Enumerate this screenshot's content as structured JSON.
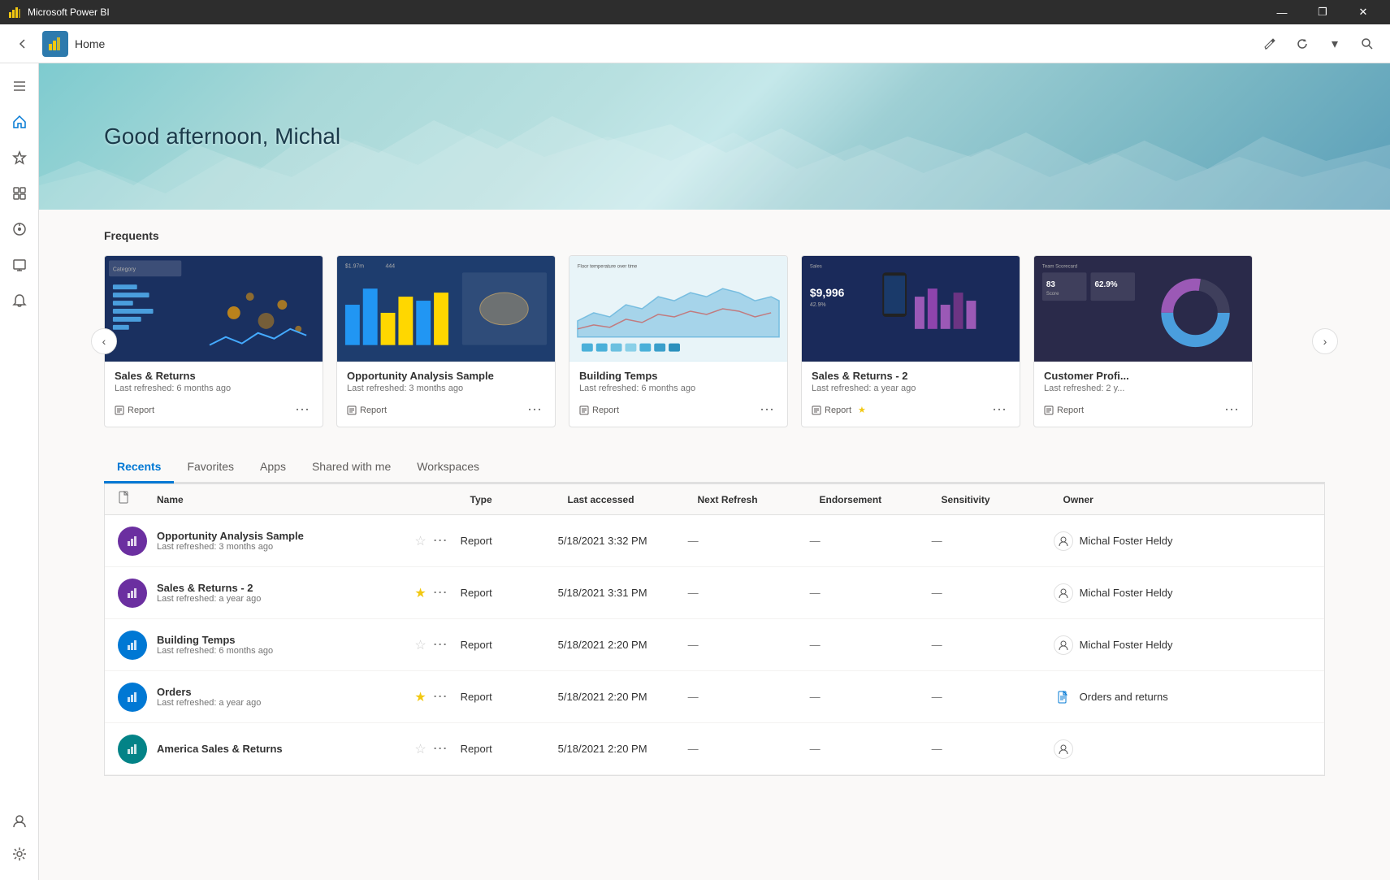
{
  "titlebar": {
    "title": "Microsoft Power BI",
    "controls": [
      "—",
      "❐",
      "✕"
    ]
  },
  "topbar": {
    "back_label": "‹",
    "logo_alt": "Power BI logo",
    "page_title": "Home",
    "icons": [
      "edit",
      "refresh",
      "search"
    ]
  },
  "hero": {
    "greeting": "Good afternoon, Michal"
  },
  "sidebar": {
    "items": [
      {
        "label": "☰",
        "name": "menu",
        "active": false
      },
      {
        "label": "⌂",
        "name": "home",
        "active": true
      },
      {
        "label": "★",
        "name": "favorites",
        "active": false
      },
      {
        "label": "⊞",
        "name": "apps",
        "active": false
      },
      {
        "label": "◎",
        "name": "metrics",
        "active": false
      },
      {
        "label": "💬",
        "name": "activity",
        "active": false
      },
      {
        "label": "🔔",
        "name": "notifications",
        "active": false
      },
      {
        "label": "⚙",
        "name": "settings-bottom",
        "active": false
      },
      {
        "label": "👤",
        "name": "account",
        "active": false
      }
    ]
  },
  "frequents": {
    "title": "Frequents",
    "cards": [
      {
        "name": "Sales & Returns",
        "sub": "Last refreshed: 6 months ago",
        "type": "Report",
        "thumb_class": "thumb-sales"
      },
      {
        "name": "Opportunity Analysis Sample",
        "sub": "Last refreshed: 3 months ago",
        "type": "Report",
        "thumb_class": "thumb-opportunity"
      },
      {
        "name": "Building Temps",
        "sub": "Last refreshed: 6 months ago",
        "type": "Report",
        "thumb_class": "thumb-building"
      },
      {
        "name": "Sales & Returns  - 2",
        "sub": "Last refreshed: a year ago",
        "type": "Report",
        "thumb_class": "thumb-sales2",
        "starred": true
      },
      {
        "name": "Customer Profi...",
        "sub": "Last refreshed: 2 y...",
        "type": "Report",
        "thumb_class": "thumb-customer"
      }
    ]
  },
  "tabs": [
    {
      "label": "Recents",
      "active": true
    },
    {
      "label": "Favorites",
      "active": false
    },
    {
      "label": "Apps",
      "active": false
    },
    {
      "label": "Shared with me",
      "active": false
    },
    {
      "label": "Workspaces",
      "active": false
    }
  ],
  "table": {
    "headers": {
      "name": "Name",
      "type": "Type",
      "last_accessed": "Last accessed",
      "next_refresh": "Next Refresh",
      "endorsement": "Endorsement",
      "sensitivity": "Sensitivity",
      "owner": "Owner"
    },
    "rows": [
      {
        "icon_color": "icon-purple",
        "icon": "📊",
        "name": "Opportunity Analysis Sample",
        "sub": "Last refreshed: 3 months ago",
        "starred": false,
        "type": "Report",
        "accessed": "5/18/2021 3:32 PM",
        "refresh": "—",
        "endorsement": "—",
        "sensitivity": "—",
        "owner": "Michal Foster Heldy",
        "owner_type": "person"
      },
      {
        "icon_color": "icon-purple",
        "icon": "📊",
        "name": "Sales & Returns  - 2",
        "sub": "Last refreshed: a year ago",
        "starred": true,
        "type": "Report",
        "accessed": "5/18/2021 3:31 PM",
        "refresh": "—",
        "endorsement": "—",
        "sensitivity": "—",
        "owner": "Michal Foster Heldy",
        "owner_type": "person"
      },
      {
        "icon_color": "icon-blue",
        "icon": "📊",
        "name": "Building Temps",
        "sub": "Last refreshed: 6 months ago",
        "starred": false,
        "type": "Report",
        "accessed": "5/18/2021 2:20 PM",
        "refresh": "—",
        "endorsement": "—",
        "sensitivity": "—",
        "owner": "Michal Foster Heldy",
        "owner_type": "person"
      },
      {
        "icon_color": "icon-blue",
        "icon": "📊",
        "name": "Orders",
        "sub": "Last refreshed: a year ago",
        "starred": true,
        "type": "Report",
        "accessed": "5/18/2021 2:20 PM",
        "refresh": "—",
        "endorsement": "—",
        "sensitivity": "—",
        "owner": "Orders and returns",
        "owner_type": "doc"
      },
      {
        "icon_color": "icon-teal",
        "icon": "📊",
        "name": "America Sales & Returns",
        "sub": "",
        "starred": false,
        "type": "Report",
        "accessed": "5/18/2021 2:20 PM",
        "refresh": "—",
        "endorsement": "—",
        "sensitivity": "—",
        "owner": "",
        "owner_type": "person"
      }
    ]
  }
}
